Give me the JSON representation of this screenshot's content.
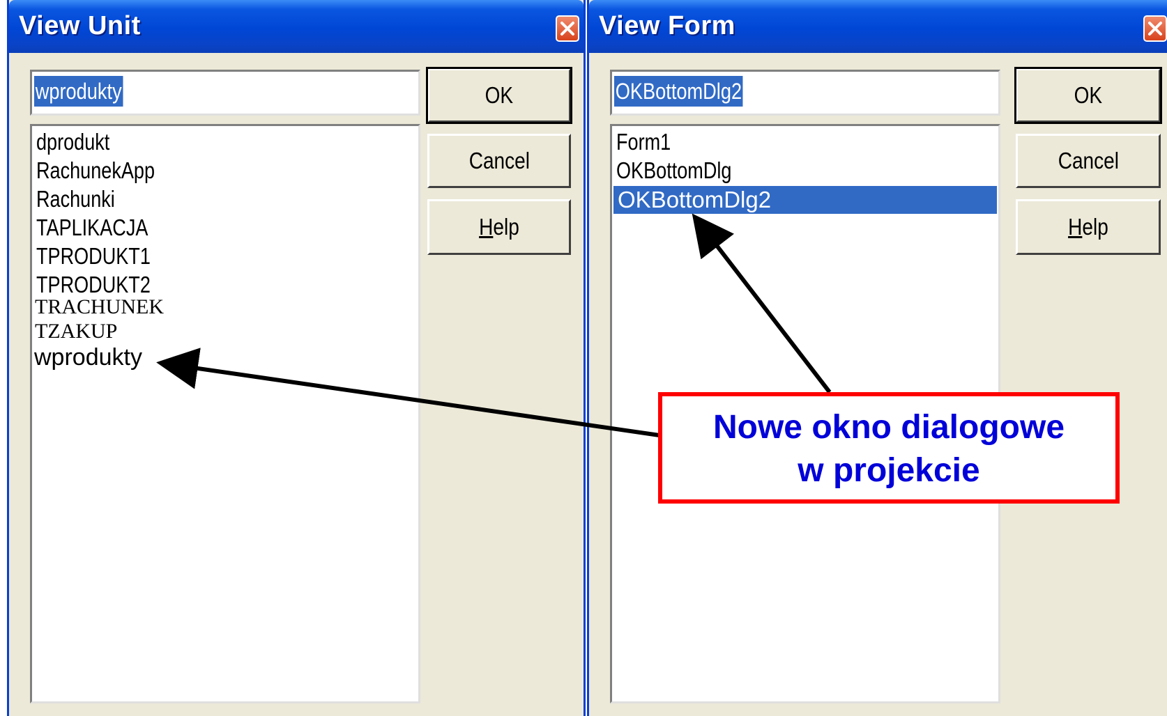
{
  "view_unit": {
    "title": "View Unit",
    "input_value": "wprodukty",
    "ok_label": "OK",
    "cancel_label": "Cancel",
    "help_label_u": "H",
    "help_label_rest": "elp",
    "items": [
      "dprodukt",
      "RachunekApp",
      "Rachunki",
      "TAPLIKACJA",
      "TPRODUKT1",
      "TPRODUKT2",
      "TRACHUNEK",
      "TZAKUP",
      "wprodukty"
    ]
  },
  "view_form": {
    "title": "View Form",
    "input_value": "OKBottomDlg2",
    "ok_label": "OK",
    "cancel_label": "Cancel",
    "help_label_u": "H",
    "help_label_rest": "elp",
    "items": [
      "Form1",
      "OKBottomDlg",
      "OKBottomDlg2"
    ],
    "selected_item": "OKBottomDlg2"
  },
  "callout": {
    "line1": "Nowe okno dialogowe",
    "line2": "w projekcie"
  },
  "colors": {
    "titlebar": "#0046d5",
    "selection": "#316ac5",
    "callout_border": "#ff0000",
    "callout_text": "#0000d8",
    "dialog_bg": "#ece9d8"
  }
}
